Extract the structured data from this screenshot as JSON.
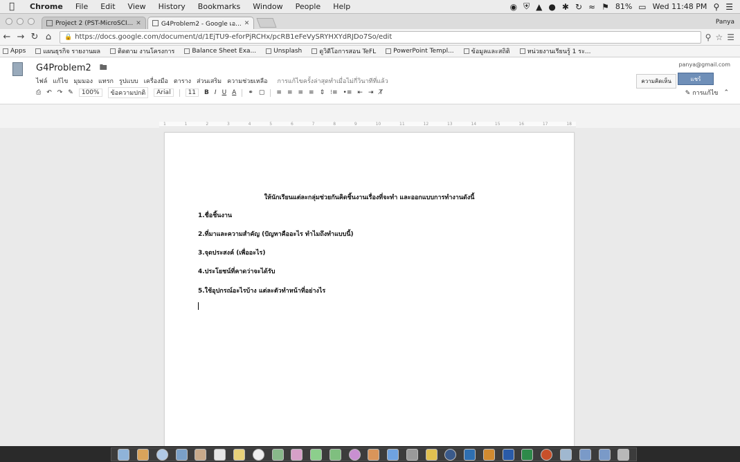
{
  "menubar": {
    "app": "Chrome",
    "items": [
      "File",
      "Edit",
      "View",
      "History",
      "Bookmarks",
      "Window",
      "People",
      "Help"
    ],
    "battery": "81%",
    "clock": "Wed 11:48 PM"
  },
  "tabs": [
    {
      "label": "Project 2 (PST-MicroSCI...",
      "active": false
    },
    {
      "label": "G4Problem2 - Google เอ...",
      "active": true
    }
  ],
  "profile_name": "Panya",
  "address": {
    "url": "https://docs.google.com/document/d/1EjTU9-eforPjRCHx/pcRB1eFeVySRYHXYdRJDo7So/edit"
  },
  "bookmarks": [
    {
      "label": "Apps"
    },
    {
      "label": "แผนธุรกิจ รายงานผล"
    },
    {
      "label": "ติดตาม งานโครงการ"
    },
    {
      "label": "Balance Sheet Exa..."
    },
    {
      "label": "Unsplash"
    },
    {
      "label": "ดูวิดีโอการสอน TeFL"
    },
    {
      "label": "PowerPoint Templ..."
    },
    {
      "label": "ข้อมูลและสถิติ"
    },
    {
      "label": "หน่วยงานเรียนรู้ 1 ระ..."
    }
  ],
  "docs": {
    "title": "G4Problem2",
    "menus": [
      "ไฟล์",
      "แก้ไข",
      "มุมมอง",
      "แทรก",
      "รูปแบบ",
      "เครื่องมือ",
      "ตาราง",
      "ส่วนเสริม",
      "ความช่วยเหลือ"
    ],
    "save_note": "การแก้ไขครั้งล่าสุดทำเมื่อไม่กี่วินาทีที่แล้ว",
    "user_email": "panya@gmail.com",
    "comments_label": "ความคิดเห็น",
    "share_label": "แชร์",
    "toolbar": {
      "zoom": "100%",
      "style": "ข้อความปกติ",
      "font": "Arial",
      "size": "11",
      "bold": "B",
      "italic": "I",
      "underline": "U",
      "text_color": "A",
      "editing": "การแก้ไข"
    },
    "ruler_ticks": [
      "1",
      "1",
      "2",
      "3",
      "4",
      "5",
      "6",
      "7",
      "8",
      "9",
      "10",
      "11",
      "12",
      "13",
      "14",
      "15",
      "16",
      "17",
      "18"
    ]
  },
  "document": {
    "heading": "ให้นักเรียนแต่ละกลุ่มช่วยกันคิดชิ้นงานเรื่องที่จะทำ และออกแบบการทำงานดังนี้",
    "items": [
      "1.ชื่อชิ้นงาน",
      "2.ที่มาและความสำคัญ (ปัญหาคืออะไร ทำไมถึงทำแบบนี้)",
      "3.จุดประสงค์ (เพื่ออะไร)",
      "4.ประโยชน์ที่คาดว่าจะได้รับ",
      "5.ใช้อุปกรณ์อะไรบ้าง แต่ละตัวทำหน้าที่อย่างไร"
    ]
  },
  "dock_apps": [
    "Finder",
    "Launchpad",
    "Safari",
    "Mail",
    "Contacts",
    "Calendar",
    "Notes",
    "Reminders",
    "Maps",
    "Photos",
    "Messages",
    "FaceTime",
    "iTunes",
    "iBooks",
    "App Store",
    "System Preferences",
    "Chrome",
    "Lightroom",
    "Photoshop",
    "Illustrator",
    "Word",
    "Excel",
    "PowerPoint",
    "Preview",
    "Downloads",
    "Documents",
    "Trash"
  ]
}
